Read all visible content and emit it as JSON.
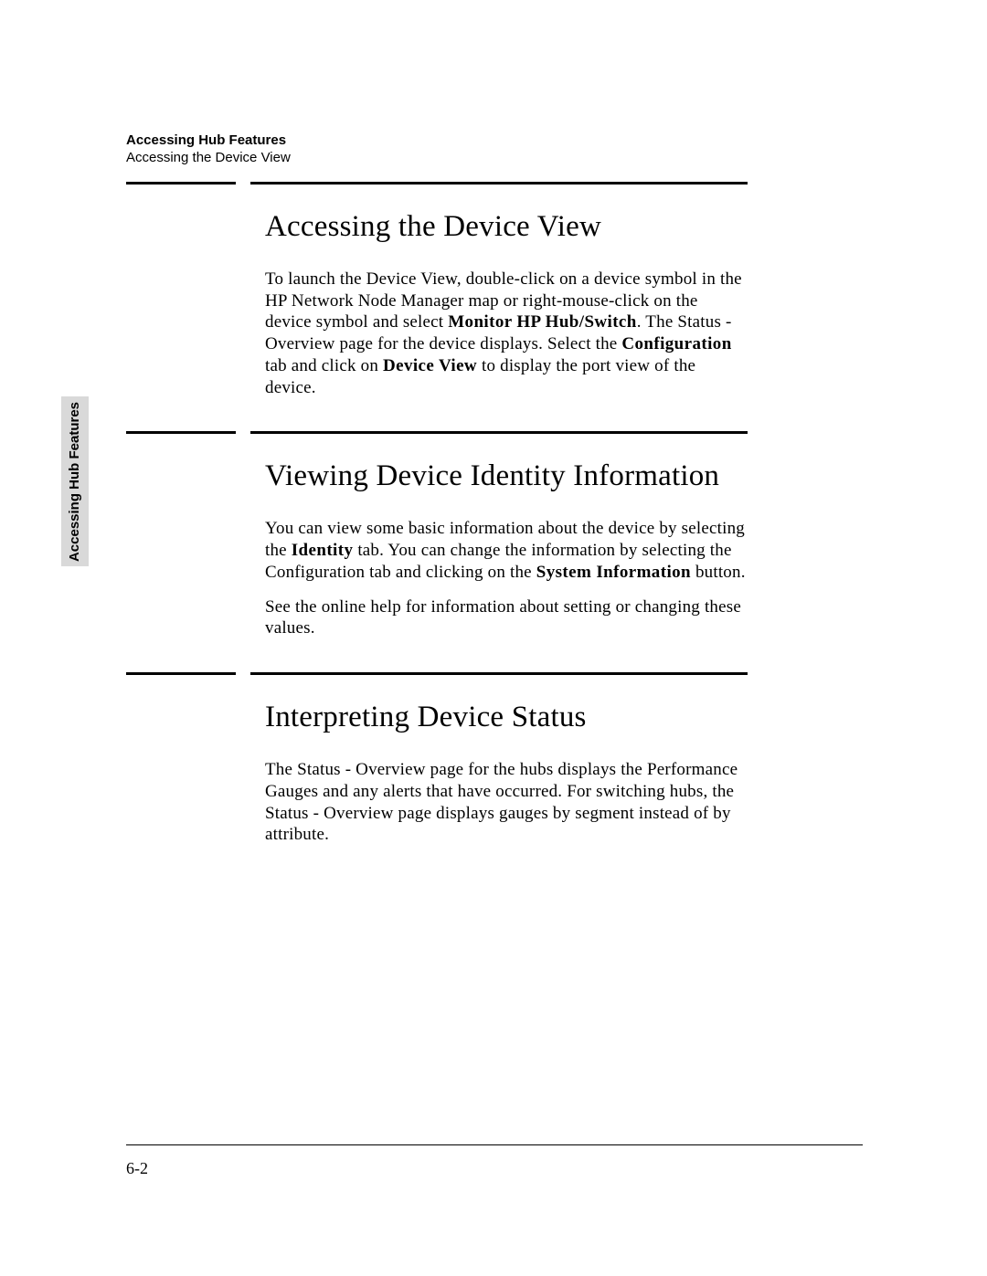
{
  "running_head": {
    "chapter": "Accessing Hub Features",
    "section": "Accessing the Device View"
  },
  "side_tab": "Accessing Hub Features",
  "sections": {
    "s1": {
      "title": "Accessing the Device View",
      "p1_a": "To launch the Device View, double-click on a device symbol in the HP Network Node Manager map or right-mouse-click on the device symbol and select ",
      "p1_b1": "Monitor HP Hub/Switch",
      "p1_c": ". The Status - Overview page for the device displays. Select the ",
      "p1_b2": "Configuration",
      "p1_d": " tab and click on ",
      "p1_b3": "Device View",
      "p1_e": " to display the port view of the device."
    },
    "s2": {
      "title": "Viewing Device Identity Information",
      "p1_a": "You can view some basic information about the device by selecting the ",
      "p1_b1": "Identity",
      "p1_c": " tab. You can change the information by selecting the Configuration tab and clicking on the ",
      "p1_b2": "System Information",
      "p1_d": " button.",
      "p2": "See the online help for information about setting or changing these values."
    },
    "s3": {
      "title": "Interpreting Device Status",
      "p1": "The Status - Overview page for the hubs displays the Performance Gauges and any alerts that have occurred. For switching hubs, the Status - Overview page displays gauges by segment instead of by attribute."
    }
  },
  "page_number": "6-2"
}
